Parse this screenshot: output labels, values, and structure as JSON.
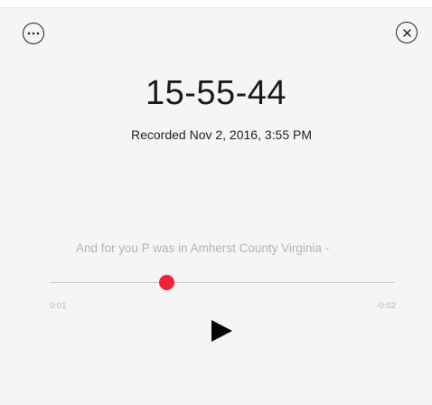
{
  "header": {
    "more_icon": "ellipsis-circle-icon",
    "close_icon": "close-circle-icon"
  },
  "recording": {
    "title": "15-55-44",
    "recorded_label": "Recorded Nov 2, 2016, 3:55 PM",
    "transcript": "And for you P was in Amherst County Virginia -"
  },
  "player": {
    "elapsed": "0:01",
    "remaining": "-0:02",
    "progress": 0.34,
    "accent_color": "#f2213a",
    "play_icon": "play-icon"
  }
}
